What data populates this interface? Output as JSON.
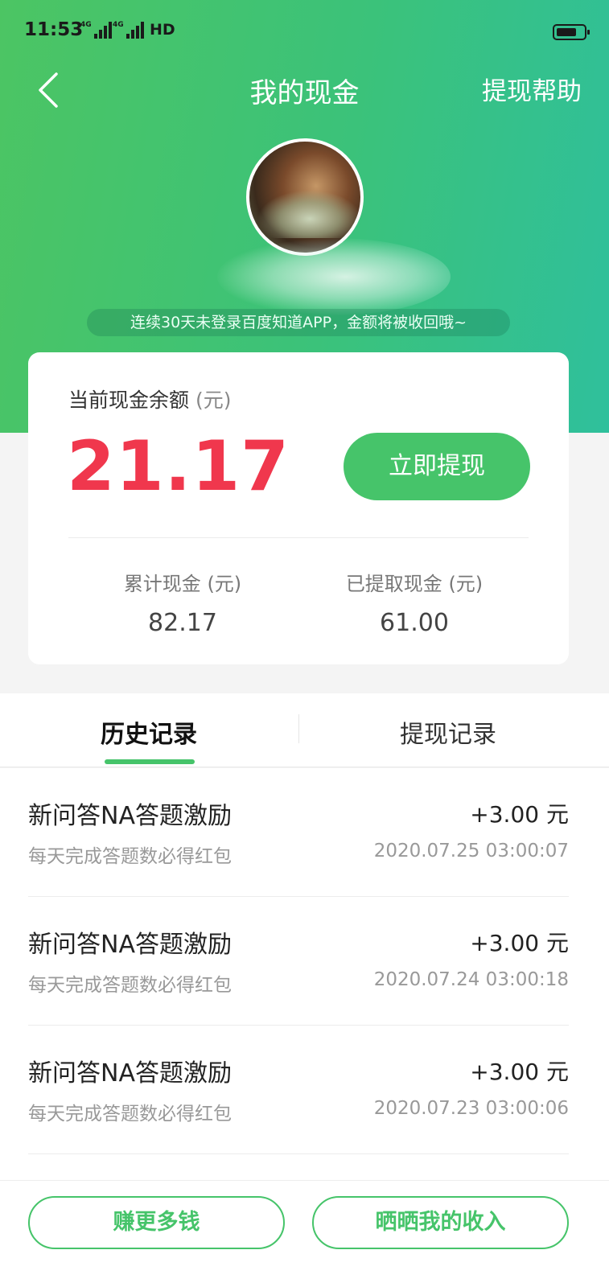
{
  "status_bar": {
    "time": "11:53",
    "network_1": "4G",
    "network_2": "4G",
    "hd": "HD",
    "battery_level": 0.8
  },
  "nav": {
    "title": "我的现金",
    "help_label": "提现帮助"
  },
  "notice": "连续30天未登录百度知道APP，金额将被收回哦~",
  "balance": {
    "label": "当前现金余额",
    "unit": "(元)",
    "amount": "21.17",
    "withdraw_label": "立即提现"
  },
  "stats": [
    {
      "label": "累计现金 (元)",
      "value": "82.17"
    },
    {
      "label": "已提取现金 (元)",
      "value": "61.00"
    }
  ],
  "tabs": [
    {
      "label": "历史记录",
      "active": true
    },
    {
      "label": "提现记录",
      "active": false
    }
  ],
  "records": [
    {
      "title": "新问答NA答题激励",
      "amount": "+3.00 元",
      "subtitle": "每天完成答题数必得红包",
      "time": "2020.07.25 03:00:07"
    },
    {
      "title": "新问答NA答题激励",
      "amount": "+3.00 元",
      "subtitle": "每天完成答题数必得红包",
      "time": "2020.07.24 03:00:18"
    },
    {
      "title": "新问答NA答题激励",
      "amount": "+3.00 元",
      "subtitle": "每天完成答题数必得红包",
      "time": "2020.07.23 03:00:06"
    }
  ],
  "bottom": {
    "earn_label": "赚更多钱",
    "share_label": "晒晒我的收入"
  },
  "colors": {
    "brand_green": "#46c46a",
    "amount_red": "#f0374d",
    "header_gradient_start": "#4cc563",
    "header_gradient_end": "#2fc09c"
  }
}
